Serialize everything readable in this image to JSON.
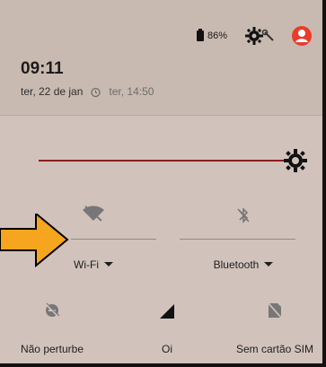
{
  "status": {
    "battery_percent": "86%"
  },
  "header": {
    "time": "09:11",
    "date": "ter, 22 de jan",
    "alarm": "ter, 14:50"
  },
  "brightness": {
    "level": 0.92
  },
  "tiles": {
    "wifi": "Wi-Fi",
    "bluetooth": "Bluetooth",
    "dnd": "Não perturbe",
    "carrier": "Oi",
    "sim": "Sem cartão SIM"
  },
  "colors": {
    "slider": "#8a1f1f",
    "avatar": "#ea3b2b",
    "arrow": "#f5a51e"
  },
  "icons": {
    "settings": "settings-gear-wrench-icon",
    "avatar": "account-avatar-icon",
    "alarm": "alarm-clock-icon",
    "brightness": "brightness-icon",
    "wifi": "wifi-off-icon",
    "bluetooth": "bluetooth-off-icon",
    "dnd": "do-not-disturb-icon",
    "signal": "signal-icon",
    "sim": "no-sim-icon",
    "pointer": "orange-arrow-pointer"
  }
}
